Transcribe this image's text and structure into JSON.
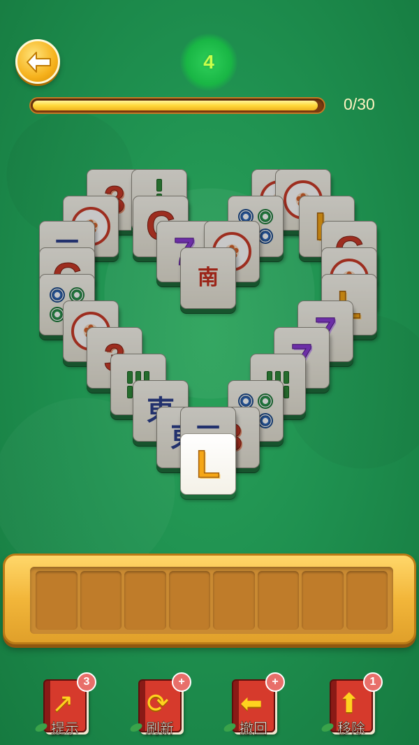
{
  "header": {
    "back_icon": "back-arrow-icon",
    "level": "4",
    "progress_text": "0/30",
    "progress_fraction": 0.98
  },
  "tiles": [
    {
      "name": "tile-three",
      "glyph": "3",
      "kind": "num"
    },
    {
      "name": "tile-bamboo",
      "glyph": "bamboo2",
      "kind": "bamboo2"
    },
    {
      "name": "tile-medal",
      "glyph": "medal",
      "kind": "medal"
    },
    {
      "name": "tile-C",
      "glyph": "C",
      "kind": "C"
    },
    {
      "name": "tile-seven",
      "glyph": "7",
      "kind": "seven"
    },
    {
      "name": "tile-south",
      "glyph": "南",
      "kind": "cjk-red"
    },
    {
      "name": "tile-dots",
      "glyph": "dots",
      "kind": "dots"
    },
    {
      "name": "tile-L",
      "glyph": "L",
      "kind": "L"
    },
    {
      "name": "tile-three-cjk",
      "glyph": "三",
      "kind": "cjk-blue"
    },
    {
      "name": "tile-east",
      "glyph": "東",
      "kind": "cjk-blue"
    },
    {
      "name": "tile-bamboo6",
      "glyph": "bamboo6",
      "kind": "bamboo"
    },
    {
      "name": "tile-L-selected",
      "glyph": "L",
      "kind": "L"
    }
  ],
  "tray": {
    "slots": 8
  },
  "tools": [
    {
      "label": "提示",
      "badge": "3",
      "icon": "hint-arrow-icon"
    },
    {
      "label": "刷新",
      "badge": "+",
      "icon": "refresh-icon"
    },
    {
      "label": "撤回",
      "badge": "+",
      "icon": "undo-arrow-icon"
    },
    {
      "label": "移除",
      "badge": "1",
      "icon": "remove-up-arrow-icon"
    }
  ],
  "colors": {
    "background": "#1f9150",
    "tray": "#f2b63a",
    "accent": "#ffd83a"
  }
}
